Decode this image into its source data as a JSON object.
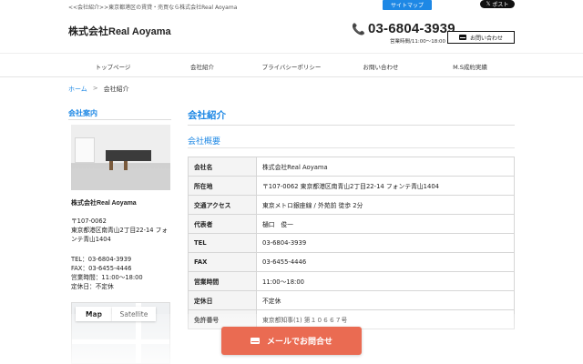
{
  "topbar": {
    "tagline": "<<会社紹介>>東京都港区の賃貸・売買なら株式会社Real Aoyama",
    "sitemap_label": "サイトマップ",
    "x_post_label": "ポスト",
    "x_logo": "𝕏"
  },
  "header": {
    "brand": "株式会社Real Aoyama",
    "phone": "03-6804-3939",
    "hours": "営業時間/11:00～18:00",
    "contact_label": "お問い合わせ"
  },
  "nav": {
    "items": [
      {
        "label": "トップページ"
      },
      {
        "label": "会社紹介"
      },
      {
        "label": "プライバシーポリシー"
      },
      {
        "label": "お問い合わせ"
      },
      {
        "label": "M.S成約実績"
      }
    ]
  },
  "breadcrumb": {
    "home": "ホーム",
    "sep": ">",
    "current": "会社紹介"
  },
  "sidebar": {
    "title": "会社案内",
    "company_name": "株式会社Real Aoyama",
    "postal": "〒107-0062",
    "address": "東京都港区南青山2丁目22-14 フォ",
    "address2": "ンテ青山1404",
    "tel": "TEL：03-6804-3939",
    "fax": "FAX：03-6455-4446",
    "hours": "営業時間：11:00～18:00",
    "holiday": "定休日：不定休",
    "map_tab": "Map",
    "satellite_tab": "Satellite"
  },
  "main": {
    "title": "会社紹介",
    "subtitle": "会社概要",
    "rows": [
      {
        "label": "会社名",
        "value": "株式会社Real Aoyama"
      },
      {
        "label": "所在地",
        "value": "〒107-0062 東京都港区南青山2丁目22-14 フォンテ青山1404"
      },
      {
        "label": "交通アクセス",
        "value": "東京メトロ銀座線 / 外苑前 徒歩 2分"
      },
      {
        "label": "代表者",
        "value": "樋口　俊一"
      },
      {
        "label": "TEL",
        "value": "03-6804-3939"
      },
      {
        "label": "FAX",
        "value": "03-6455-4446"
      },
      {
        "label": "営業時間",
        "value": "11:00～18:00"
      },
      {
        "label": "定休日",
        "value": "不定休"
      },
      {
        "label": "免許番号",
        "value": "東京都知事(1) 第１０６６７号"
      }
    ]
  },
  "cta": {
    "label": "メールでお問合せ"
  }
}
